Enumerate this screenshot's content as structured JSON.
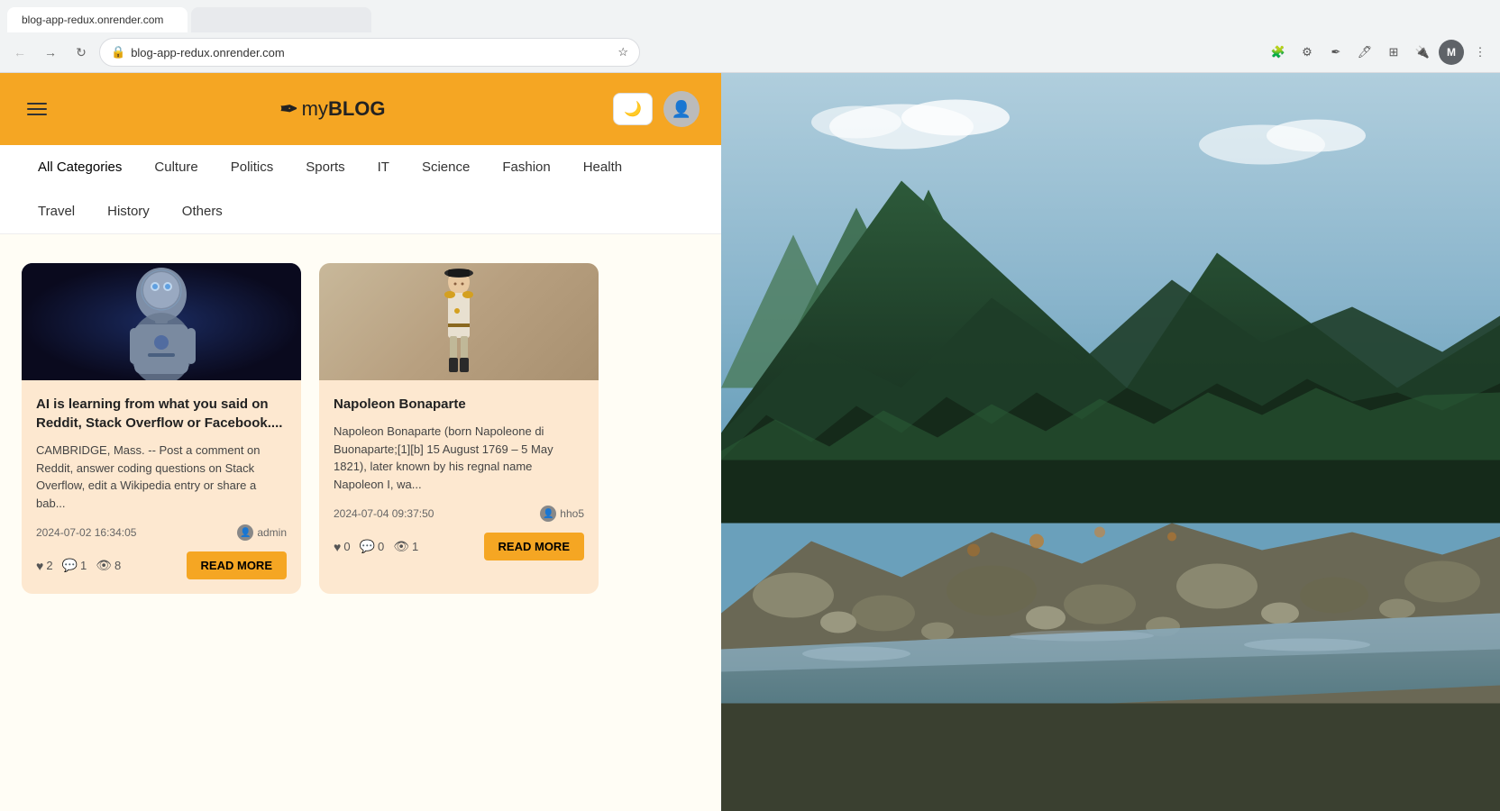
{
  "browser": {
    "url": "blog-app-redux.onrender.com",
    "tab_label": "blog-app-redux.onrender.com"
  },
  "header": {
    "logo_text": "myBLOG",
    "menu_label": "Menu",
    "dark_mode_icon": "🌙",
    "user_icon": "👤"
  },
  "nav": {
    "items": [
      {
        "label": "All Categories",
        "active": true
      },
      {
        "label": "Culture",
        "active": false
      },
      {
        "label": "Politics",
        "active": false
      },
      {
        "label": "Sports",
        "active": false
      },
      {
        "label": "IT",
        "active": false
      },
      {
        "label": "Science",
        "active": false
      },
      {
        "label": "Fashion",
        "active": false
      },
      {
        "label": "Health",
        "active": false
      },
      {
        "label": "Travel",
        "active": false
      },
      {
        "label": "History",
        "active": false
      },
      {
        "label": "Others",
        "active": false
      }
    ]
  },
  "cards": [
    {
      "id": 1,
      "title": "AI is learning from what you said on Reddit, Stack Overflow or Facebook....",
      "excerpt": "CAMBRIDGE, Mass. -- Post a comment on Reddit, answer coding questions on Stack Overflow, edit a Wikipedia entry or share a bab...",
      "date": "2024-07-02 16:34:05",
      "author": "admin",
      "likes": 2,
      "comments": 1,
      "views": 8,
      "read_more": "READ MORE"
    },
    {
      "id": 2,
      "title": "Napoleon Bonaparte",
      "excerpt": "Napoleon Bonaparte (born Napoleone di Buonaparte;[1][b] 15 August 1769 – 5 May 1821), later known by his regnal name Napoleon I, wa...",
      "date": "2024-07-04 09:37:50",
      "author": "hho5",
      "likes": 0,
      "comments": 0,
      "views": 1,
      "read_more": "READ MORE"
    }
  ]
}
